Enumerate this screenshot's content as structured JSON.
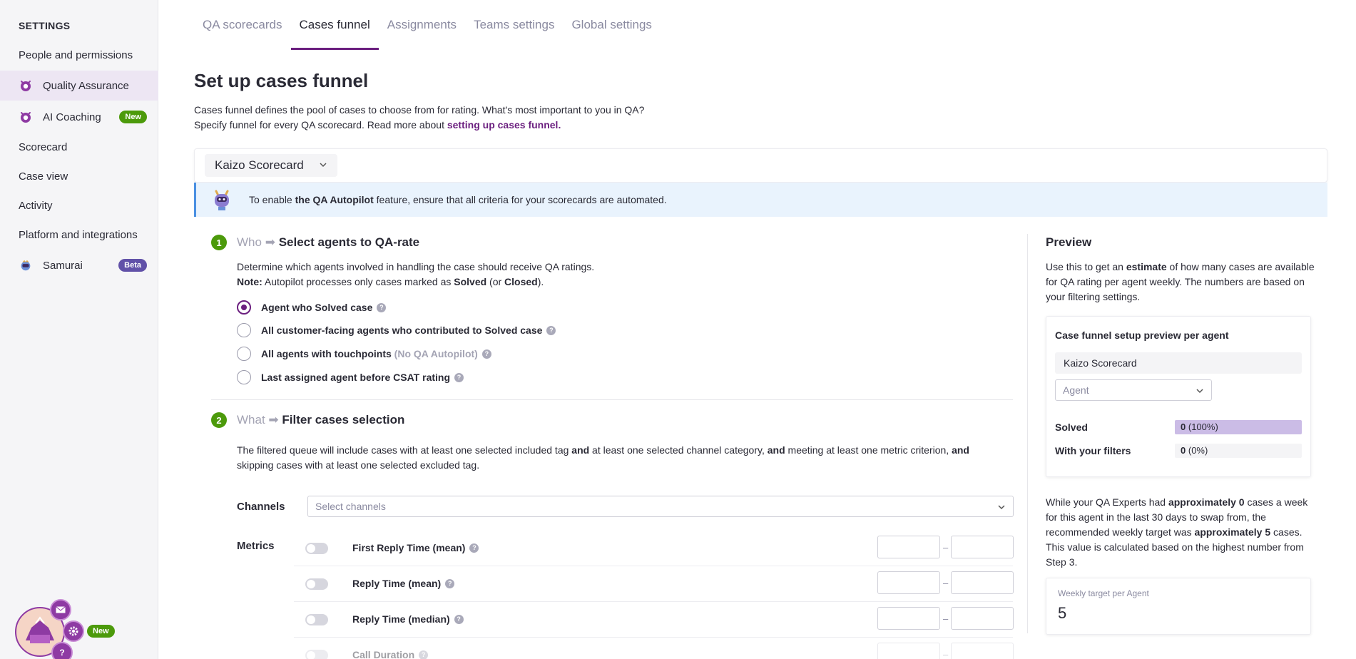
{
  "sidebar": {
    "heading": "SETTINGS",
    "items": [
      {
        "label": "People and permissions"
      },
      {
        "label": "Quality Assurance"
      },
      {
        "label": "AI Coaching",
        "badge": "New"
      },
      {
        "label": "Scorecard"
      },
      {
        "label": "Case view"
      },
      {
        "label": "Activity"
      },
      {
        "label": "Platform and integrations"
      },
      {
        "label": "Samurai",
        "badge": "Beta"
      }
    ],
    "assistant_badge": "New"
  },
  "tabs": [
    {
      "label": "QA scorecards"
    },
    {
      "label": "Cases funnel"
    },
    {
      "label": "Assignments"
    },
    {
      "label": "Teams settings"
    },
    {
      "label": "Global settings"
    }
  ],
  "page": {
    "title": "Set up cases funnel",
    "desc_line1": "Cases funnel defines the pool of cases to choose from for rating. What's most important to you in QA?",
    "desc_line2": "Specify funnel for every QA scorecard. Read more about ",
    "desc_link": "setting up cases funnel."
  },
  "scorecard_select": {
    "value": "Kaizo Scorecard"
  },
  "banner": {
    "pre": "To enable ",
    "strong": "the QA Autopilot",
    "post": " feature, ensure that all criteria for your scorecards are automated."
  },
  "step1": {
    "num": "1",
    "who": "Who",
    "arrow": "➡",
    "title": "Select agents to QA-rate",
    "para1": "Determine which agents involved in handling the case should receive QA ratings.",
    "note_label": "Note:",
    "note_pre": " Autopilot processes only cases marked as ",
    "note_solved": "Solved",
    "note_mid": " (or ",
    "note_closed": "Closed",
    "note_post": ").",
    "options": [
      {
        "label": "Agent who Solved case",
        "checked": true
      },
      {
        "label": "All customer-facing agents who contributed to Solved case"
      },
      {
        "label": "All agents with touchpoints",
        "suffix": "(No QA Autopilot)"
      },
      {
        "label": "Last assigned agent before CSAT rating"
      }
    ]
  },
  "step2": {
    "num": "2",
    "what": "What",
    "arrow": "➡",
    "title": "Filter cases selection",
    "p_a": "The filtered queue will include cases with at least one selected included tag ",
    "p_and1": "and",
    "p_b": " at least one selected channel category, ",
    "p_and2": "and",
    "p_c": " meeting at least one metric criterion, ",
    "p_and3": "and",
    "p_d": "skipping cases with at least one selected excluded tag.",
    "channels_label": "Channels",
    "channels_placeholder": "Select channels",
    "metrics_label": "Metrics",
    "metrics": [
      {
        "name": "First Reply Time (mean)",
        "dash": "–"
      },
      {
        "name": "Reply Time (mean)",
        "dash": "–"
      },
      {
        "name": "Reply Time (median)",
        "dash": "–"
      },
      {
        "name": "Call Duration",
        "dash": "–"
      }
    ]
  },
  "preview": {
    "title": "Preview",
    "p_pre": "Use this to get an ",
    "p_strong": "estimate",
    "p_post": " of how many cases are available for QA rating per agent weekly. The numbers are based on your filtering settings.",
    "card_title": "Case funnel setup preview per agent",
    "card_scorecard": "Kaizo Scorecard",
    "agent_placeholder": "Agent",
    "solved_label": "Solved",
    "solved_count": "0",
    "solved_pct": "(100%)",
    "solved_fraction": 1.0,
    "filters_label": "With your filters",
    "filters_count": "0",
    "filters_pct": "(0%)",
    "filters_fraction": 0.0,
    "w_a": "While your QA Experts had ",
    "w_b": "approximately 0",
    "w_c": " cases a week for this agent in the last 30 days to swap from, the recommended weekly target was ",
    "w_d": "approximately 5",
    "w_e": " cases. This value is calculated based on the highest number from Step 3.",
    "weekly_label": "Weekly target per Agent",
    "weekly_value": "5"
  },
  "colors": {
    "accent": "#6b1f7f",
    "step_green": "#4c9a0b",
    "banner_bg": "#e9f3fd",
    "preview_fill": "#cbbce6"
  }
}
